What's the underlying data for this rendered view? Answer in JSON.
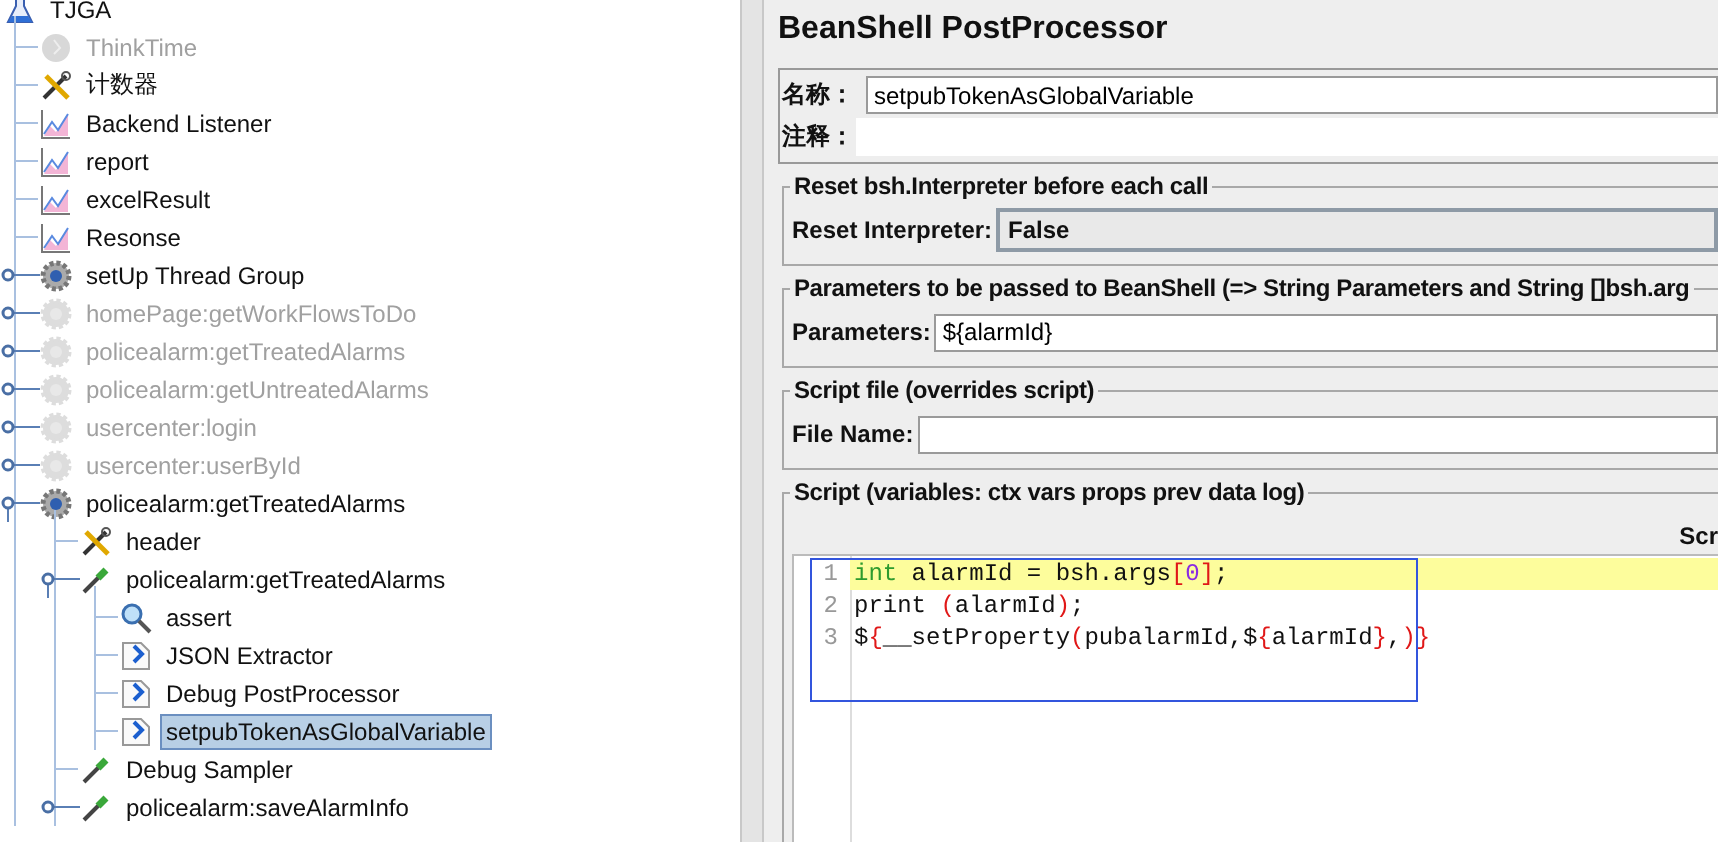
{
  "tree": {
    "label": "TJGA",
    "kind": "test-plan",
    "disabled": false,
    "selected": false,
    "children": [
      {
        "label": "ThinkTime",
        "kind": "timer",
        "disabled": true,
        "selected": false
      },
      {
        "label": "计数器",
        "kind": "wrench",
        "disabled": false,
        "selected": false
      },
      {
        "label": "Backend Listener",
        "kind": "graph",
        "disabled": false,
        "selected": false
      },
      {
        "label": "report",
        "kind": "graph",
        "disabled": false,
        "selected": false
      },
      {
        "label": "excelResult",
        "kind": "graph",
        "disabled": false,
        "selected": false
      },
      {
        "label": "Resonse",
        "kind": "graph",
        "disabled": false,
        "selected": false
      },
      {
        "label": "setUp Thread Group",
        "kind": "gear",
        "disabled": false,
        "selected": false,
        "expanded": false
      },
      {
        "label": "homePage:getWorkFlowsToDo",
        "kind": "gear",
        "disabled": true,
        "selected": false,
        "expanded": false
      },
      {
        "label": "policealarm:getTreatedAlarms",
        "kind": "gear",
        "disabled": true,
        "selected": false,
        "expanded": false
      },
      {
        "label": "policealarm:getUntreatedAlarms",
        "kind": "gear",
        "disabled": true,
        "selected": false,
        "expanded": false
      },
      {
        "label": "usercenter:login",
        "kind": "gear",
        "disabled": true,
        "selected": false,
        "expanded": false
      },
      {
        "label": "usercenter:userById",
        "kind": "gear",
        "disabled": true,
        "selected": false,
        "expanded": false
      },
      {
        "label": "policealarm:getTreatedAlarms",
        "kind": "gear",
        "disabled": false,
        "selected": false,
        "expanded": true,
        "children": [
          {
            "label": "header",
            "kind": "wrench",
            "disabled": false,
            "selected": false
          },
          {
            "label": "policealarm:getTreatedAlarms",
            "kind": "dropper",
            "disabled": false,
            "selected": false,
            "expanded": true,
            "children": [
              {
                "label": "assert",
                "kind": "magnifier",
                "disabled": false,
                "selected": false
              },
              {
                "label": "JSON Extractor",
                "kind": "postproc",
                "disabled": false,
                "selected": false
              },
              {
                "label": "Debug PostProcessor",
                "kind": "postproc",
                "disabled": false,
                "selected": false
              },
              {
                "label": "setpubTokenAsGlobalVariable",
                "kind": "postproc",
                "disabled": false,
                "selected": true
              }
            ]
          },
          {
            "label": "Debug Sampler",
            "kind": "dropper",
            "disabled": false,
            "selected": false
          },
          {
            "label": "policealarm:saveAlarmInfo",
            "kind": "dropper",
            "disabled": false,
            "selected": false,
            "expanded": false
          }
        ]
      }
    ]
  },
  "panel": {
    "title": "BeanShell PostProcessor",
    "name_label": "名称：",
    "name_value": "setpubTokenAsGlobalVariable",
    "comment_label": "注释：",
    "reset_group": {
      "legend": "Reset bsh.Interpreter before each call",
      "label": "Reset Interpreter:",
      "value": "False"
    },
    "params_group": {
      "legend": "Parameters to be passed to BeanShell (=> String Parameters and String []bsh.arg",
      "label": "Parameters:",
      "value": "${alarmId}"
    },
    "file_group": {
      "legend": "Script file (overrides script)",
      "label": "File Name:"
    },
    "script_group": {
      "legend": "Script (variables: ctx vars props prev data log)",
      "column_3": "Scr",
      "lines": [
        {
          "number": "1",
          "current": true,
          "tokens": [
            {
              "text": "int",
              "kind": "keyword"
            },
            {
              "text": " alarmId = bsh.args",
              "kind": "plain"
            },
            {
              "text": "[",
              "kind": "bracket"
            },
            {
              "text": "0",
              "kind": "number"
            },
            {
              "text": "]",
              "kind": "bracket"
            },
            {
              "text": ";",
              "kind": "plain"
            }
          ]
        },
        {
          "number": "2",
          "current": false,
          "tokens": [
            {
              "text": "print ",
              "kind": "plain"
            },
            {
              "text": "(",
              "kind": "bracket"
            },
            {
              "text": "alarmId",
              "kind": "plain"
            },
            {
              "text": ")",
              "kind": "bracket"
            },
            {
              "text": ";",
              "kind": "plain"
            }
          ]
        },
        {
          "number": "3",
          "current": false,
          "tokens": [
            {
              "text": "$",
              "kind": "plain"
            },
            {
              "text": "{",
              "kind": "bracket"
            },
            {
              "text": "__setProperty",
              "kind": "plain"
            },
            {
              "text": "(",
              "kind": "bracket"
            },
            {
              "text": "pubalarmId,$",
              "kind": "plain"
            },
            {
              "text": "{",
              "kind": "bracket"
            },
            {
              "text": "alarmId",
              "kind": "plain"
            },
            {
              "text": "}",
              "kind": "bracket"
            },
            {
              "text": ",",
              "kind": "plain"
            },
            {
              "text": ")",
              "kind": "bracket"
            },
            {
              "text": "}",
              "kind": "bracket"
            }
          ]
        }
      ]
    }
  }
}
